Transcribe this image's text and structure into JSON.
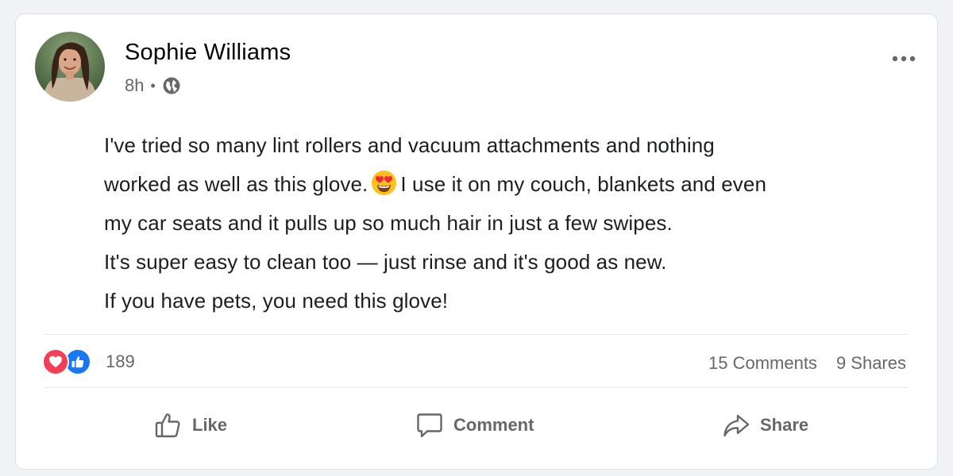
{
  "post": {
    "author": "Sophie Williams",
    "time": "8h",
    "separator": "•",
    "privacy_icon": "globe-icon",
    "menu_icon": "more-options-icon",
    "body_lines": [
      "I've tried so many lint rollers and vacuum attachments and nothing",
      "worked as well as this glove.",
      "I use it on my couch, blankets and even",
      "my car seats and it pulls up so much hair in just a few swipes.",
      "It's super easy to clean too — just rinse and it's good as new.",
      "If you have pets, you need this glove!"
    ],
    "inline_emoji": "heart-eyes-emoji"
  },
  "stats": {
    "reaction_icons": [
      "love-reaction-icon",
      "like-reaction-icon"
    ],
    "reaction_count": "189",
    "comments": "15 Comments",
    "shares": "9 Shares"
  },
  "actions": {
    "like_label": "Like",
    "comment_label": "Comment",
    "share_label": "Share"
  },
  "colors": {
    "love": "#f33e58",
    "like": "#1877f2",
    "secondary_text": "#65676b",
    "divider": "#e4e6eb"
  }
}
